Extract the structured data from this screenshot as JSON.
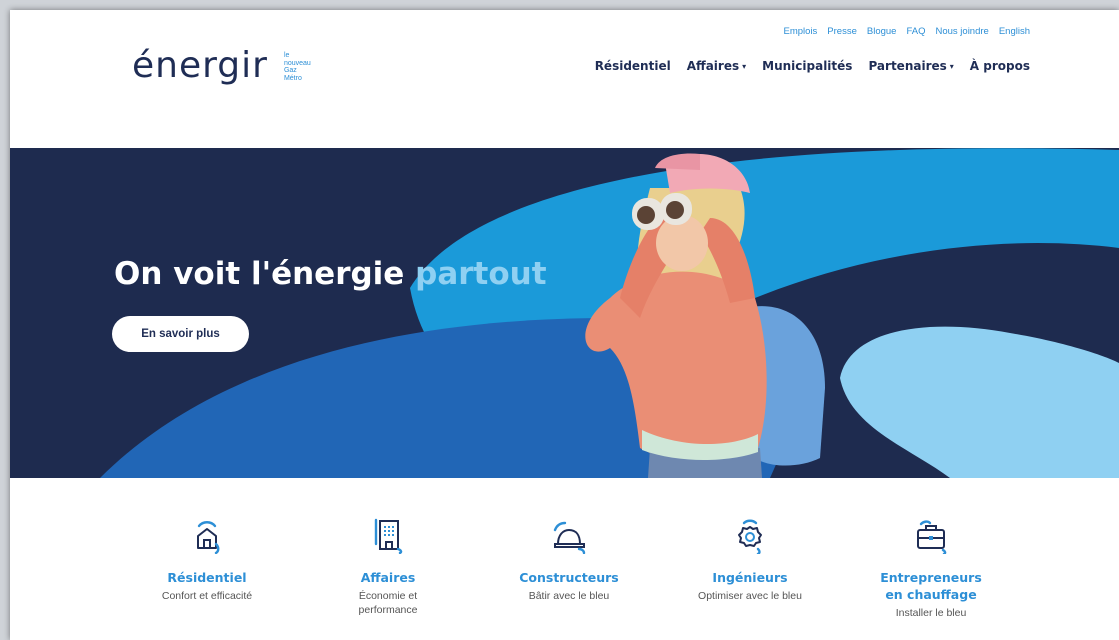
{
  "brand": {
    "logo_text": "énergir",
    "tagline": [
      "le",
      "nouveau",
      "Gaz",
      "Métro"
    ]
  },
  "utility_nav": [
    "Emplois",
    "Presse",
    "Blogue",
    "FAQ",
    "Nous joindre",
    "English"
  ],
  "main_nav": [
    {
      "label": "Résidentiel",
      "dropdown": false
    },
    {
      "label": "Affaires",
      "dropdown": true
    },
    {
      "label": "Municipalités",
      "dropdown": false
    },
    {
      "label": "Partenaires",
      "dropdown": true
    },
    {
      "label": "À propos",
      "dropdown": false
    }
  ],
  "hero": {
    "title_start": "On voit l'énergie ",
    "title_highlight": "partout",
    "cta": "En savoir plus"
  },
  "features": [
    {
      "title": "Résidentiel",
      "title2": "",
      "desc": "Confort et efficacité",
      "desc2": "",
      "icon": "house-icon"
    },
    {
      "title": "Affaires",
      "title2": "",
      "desc": "Économie et",
      "desc2": "performance",
      "icon": "building-icon"
    },
    {
      "title": "Constructeurs",
      "title2": "",
      "desc": "Bâtir avec le bleu",
      "desc2": "",
      "icon": "hard-hat-icon"
    },
    {
      "title": "Ingénieurs",
      "title2": "",
      "desc": "Optimiser avec le bleu",
      "desc2": "",
      "icon": "gear-icon"
    },
    {
      "title": "Entrepreneurs",
      "title2": "en chauffage",
      "desc": "Installer le bleu",
      "desc2": "",
      "icon": "toolbox-icon"
    }
  ],
  "colors": {
    "navy": "#1e2b4f",
    "brand_blue": "#2d8fd6",
    "light_blue": "#8fd0f2",
    "mid_blue": "#2166b6"
  }
}
